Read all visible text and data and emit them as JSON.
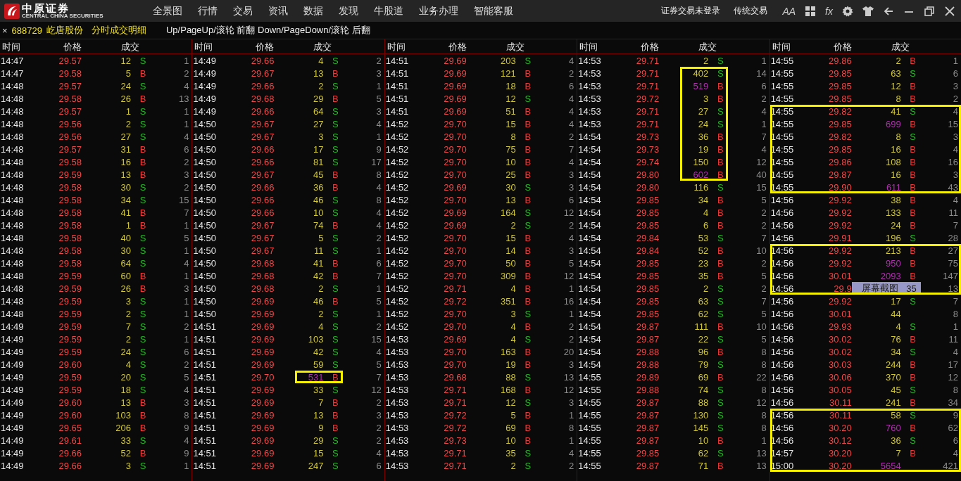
{
  "logo": {
    "name": "中原证券",
    "subtitle": "CENTRAL CHINA SECURITIES"
  },
  "menu": [
    "全景图",
    "行情",
    "交易",
    "资讯",
    "数据",
    "发现",
    "牛股道",
    "业务办理",
    "智能客服"
  ],
  "account_status": "证券交易未登录",
  "classic_trading": "传统交易",
  "tools": [
    {
      "kind": "text",
      "label": "AA"
    },
    {
      "kind": "grid"
    },
    {
      "kind": "text",
      "label": "fx"
    },
    {
      "kind": "gear"
    },
    {
      "kind": "shirt"
    },
    {
      "kind": "back"
    },
    {
      "kind": "minimize"
    },
    {
      "kind": "restore"
    },
    {
      "kind": "close"
    }
  ],
  "tab": {
    "close": "×",
    "code": "688729",
    "name": "屹唐股份",
    "title": "分时成交明细",
    "hint": "Up/PageUp/滚轮 前翻 Down/PageDown/滚轮 后翻"
  },
  "popup": {
    "label": "屏幕截图",
    "value": "35"
  },
  "columns": [
    {
      "headers": [
        "时间",
        "价格",
        "成交"
      ],
      "rows": [
        {
          "time": "14:47",
          "price": "29.57",
          "volume": "12",
          "side": "S",
          "kind": "sell",
          "trades": "1",
          "large": false,
          "boxed": false
        },
        {
          "time": "14:47",
          "price": "29.58",
          "volume": "5",
          "side": "B",
          "kind": "buy",
          "trades": "2",
          "large": false,
          "boxed": false
        },
        {
          "time": "14:48",
          "price": "29.57",
          "volume": "24",
          "side": "S",
          "kind": "sell",
          "trades": "4",
          "large": false,
          "boxed": false
        },
        {
          "time": "14:48",
          "price": "29.58",
          "volume": "26",
          "side": "B",
          "kind": "buy",
          "trades": "13",
          "large": false,
          "boxed": false
        },
        {
          "time": "14:48",
          "price": "29.57",
          "volume": "1",
          "side": "S",
          "kind": "sell",
          "trades": "1",
          "large": false,
          "boxed": false
        },
        {
          "time": "14:48",
          "price": "29.56",
          "volume": "2",
          "side": "S",
          "kind": "sell",
          "trades": "1",
          "large": false,
          "boxed": false
        },
        {
          "time": "14:48",
          "price": "29.56",
          "volume": "27",
          "side": "S",
          "kind": "sell",
          "trades": "4",
          "large": false,
          "boxed": false
        },
        {
          "time": "14:48",
          "price": "29.57",
          "volume": "31",
          "side": "B",
          "kind": "buy",
          "trades": "6",
          "large": false,
          "boxed": false
        },
        {
          "time": "14:48",
          "price": "29.58",
          "volume": "16",
          "side": "B",
          "kind": "buy",
          "trades": "2",
          "large": false,
          "boxed": false
        },
        {
          "time": "14:48",
          "price": "29.59",
          "volume": "13",
          "side": "B",
          "kind": "buy",
          "trades": "3",
          "large": false,
          "boxed": false
        },
        {
          "time": "14:48",
          "price": "29.58",
          "volume": "30",
          "side": "S",
          "kind": "sell",
          "trades": "2",
          "large": false,
          "boxed": false
        },
        {
          "time": "14:48",
          "price": "29.58",
          "volume": "34",
          "side": "S",
          "kind": "sell",
          "trades": "15",
          "large": false,
          "boxed": false
        },
        {
          "time": "14:48",
          "price": "29.58",
          "volume": "41",
          "side": "B",
          "kind": "buy",
          "trades": "7",
          "large": false,
          "boxed": false
        },
        {
          "time": "14:48",
          "price": "29.58",
          "volume": "1",
          "side": "B",
          "kind": "buy",
          "trades": "1",
          "large": false,
          "boxed": false
        },
        {
          "time": "14:48",
          "price": "29.58",
          "volume": "40",
          "side": "S",
          "kind": "sell",
          "trades": "5",
          "large": false,
          "boxed": false
        },
        {
          "time": "14:48",
          "price": "29.58",
          "volume": "30",
          "side": "S",
          "kind": "sell",
          "trades": "1",
          "large": false,
          "boxed": false
        },
        {
          "time": "14:48",
          "price": "29.58",
          "volume": "64",
          "side": "S",
          "kind": "sell",
          "trades": "4",
          "large": false,
          "boxed": false
        },
        {
          "time": "14:48",
          "price": "29.59",
          "volume": "60",
          "side": "B",
          "kind": "buy",
          "trades": "1",
          "large": false,
          "boxed": false
        },
        {
          "time": "14:48",
          "price": "29.59",
          "volume": "26",
          "side": "B",
          "kind": "buy",
          "trades": "3",
          "large": false,
          "boxed": false
        },
        {
          "time": "14:48",
          "price": "29.59",
          "volume": "3",
          "side": "S",
          "kind": "sell",
          "trades": "1",
          "large": false,
          "boxed": false
        },
        {
          "time": "14:48",
          "price": "29.59",
          "volume": "2",
          "side": "S",
          "kind": "sell",
          "trades": "1",
          "large": false,
          "boxed": false
        },
        {
          "time": "14:49",
          "price": "29.59",
          "volume": "7",
          "side": "S",
          "kind": "sell",
          "trades": "2",
          "large": false,
          "boxed": false
        },
        {
          "time": "14:49",
          "price": "29.59",
          "volume": "2",
          "side": "S",
          "kind": "sell",
          "trades": "1",
          "large": false,
          "boxed": false
        },
        {
          "time": "14:49",
          "price": "29.59",
          "volume": "24",
          "side": "S",
          "kind": "sell",
          "trades": "6",
          "large": false,
          "boxed": false
        },
        {
          "time": "14:49",
          "price": "29.60",
          "volume": "4",
          "side": "S",
          "kind": "sell",
          "trades": "2",
          "large": false,
          "boxed": false
        },
        {
          "time": "14:49",
          "price": "29.59",
          "volume": "20",
          "side": "S",
          "kind": "sell",
          "trades": "5",
          "large": false,
          "boxed": false
        },
        {
          "time": "14:49",
          "price": "29.59",
          "volume": "18",
          "side": "S",
          "kind": "sell",
          "trades": "4",
          "large": false,
          "boxed": false
        },
        {
          "time": "14:49",
          "price": "29.60",
          "volume": "13",
          "side": "B",
          "kind": "buy",
          "trades": "3",
          "large": false,
          "boxed": false
        },
        {
          "time": "14:49",
          "price": "29.60",
          "volume": "103",
          "side": "B",
          "kind": "buy",
          "trades": "8",
          "large": false,
          "boxed": false
        },
        {
          "time": "14:49",
          "price": "29.65",
          "volume": "206",
          "side": "B",
          "kind": "buy",
          "trades": "9",
          "large": false,
          "boxed": false
        },
        {
          "time": "14:49",
          "price": "29.61",
          "volume": "33",
          "side": "S",
          "kind": "sell",
          "trades": "4",
          "large": false,
          "boxed": false
        },
        {
          "time": "14:49",
          "price": "29.66",
          "volume": "52",
          "side": "B",
          "kind": "buy",
          "trades": "9",
          "large": false,
          "boxed": false
        },
        {
          "time": "14:49",
          "price": "29.66",
          "volume": "3",
          "side": "S",
          "kind": "sell",
          "trades": "1",
          "large": false,
          "boxed": false
        }
      ]
    },
    {
      "headers": [
        "时间",
        "价格",
        "成交"
      ],
      "rows": [
        {
          "time": "14:49",
          "price": "29.66",
          "volume": "4",
          "side": "S",
          "kind": "sell",
          "trades": "2",
          "large": false,
          "boxed": false
        },
        {
          "time": "14:49",
          "price": "29.67",
          "volume": "13",
          "side": "B",
          "kind": "buy",
          "trades": "3",
          "large": false,
          "boxed": false
        },
        {
          "time": "14:49",
          "price": "29.66",
          "volume": "2",
          "side": "S",
          "kind": "sell",
          "trades": "1",
          "large": false,
          "boxed": false
        },
        {
          "time": "14:49",
          "price": "29.68",
          "volume": "29",
          "side": "B",
          "kind": "buy",
          "trades": "5",
          "large": false,
          "boxed": false
        },
        {
          "time": "14:49",
          "price": "29.66",
          "volume": "64",
          "side": "S",
          "kind": "sell",
          "trades": "3",
          "large": false,
          "boxed": false
        },
        {
          "time": "14:50",
          "price": "29.67",
          "volume": "27",
          "side": "S",
          "kind": "sell",
          "trades": "4",
          "large": false,
          "boxed": false
        },
        {
          "time": "14:50",
          "price": "29.67",
          "volume": "3",
          "side": "S",
          "kind": "sell",
          "trades": "1",
          "large": false,
          "boxed": false
        },
        {
          "time": "14:50",
          "price": "29.66",
          "volume": "17",
          "side": "S",
          "kind": "sell",
          "trades": "9",
          "large": false,
          "boxed": false
        },
        {
          "time": "14:50",
          "price": "29.66",
          "volume": "81",
          "side": "S",
          "kind": "sell",
          "trades": "17",
          "large": false,
          "boxed": false
        },
        {
          "time": "14:50",
          "price": "29.67",
          "volume": "45",
          "side": "B",
          "kind": "buy",
          "trades": "8",
          "large": false,
          "boxed": false
        },
        {
          "time": "14:50",
          "price": "29.66",
          "volume": "36",
          "side": "B",
          "kind": "buy",
          "trades": "4",
          "large": false,
          "boxed": false
        },
        {
          "time": "14:50",
          "price": "29.66",
          "volume": "46",
          "side": "S",
          "kind": "sell",
          "trades": "8",
          "large": false,
          "boxed": false
        },
        {
          "time": "14:50",
          "price": "29.66",
          "volume": "10",
          "side": "S",
          "kind": "sell",
          "trades": "4",
          "large": false,
          "boxed": false
        },
        {
          "time": "14:50",
          "price": "29.67",
          "volume": "74",
          "side": "B",
          "kind": "buy",
          "trades": "4",
          "large": false,
          "boxed": false
        },
        {
          "time": "14:50",
          "price": "29.67",
          "volume": "5",
          "side": "S",
          "kind": "sell",
          "trades": "2",
          "large": false,
          "boxed": false
        },
        {
          "time": "14:50",
          "price": "29.67",
          "volume": "11",
          "side": "S",
          "kind": "sell",
          "trades": "1",
          "large": false,
          "boxed": false
        },
        {
          "time": "14:50",
          "price": "29.68",
          "volume": "41",
          "side": "B",
          "kind": "buy",
          "trades": "6",
          "large": false,
          "boxed": false
        },
        {
          "time": "14:50",
          "price": "29.68",
          "volume": "42",
          "side": "B",
          "kind": "buy",
          "trades": "7",
          "large": false,
          "boxed": false
        },
        {
          "time": "14:50",
          "price": "29.68",
          "volume": "2",
          "side": "S",
          "kind": "sell",
          "trades": "1",
          "large": false,
          "boxed": false
        },
        {
          "time": "14:50",
          "price": "29.69",
          "volume": "46",
          "side": "B",
          "kind": "buy",
          "trades": "5",
          "large": false,
          "boxed": false
        },
        {
          "time": "14:50",
          "price": "29.69",
          "volume": "2",
          "side": "S",
          "kind": "sell",
          "trades": "1",
          "large": false,
          "boxed": false
        },
        {
          "time": "14:51",
          "price": "29.69",
          "volume": "4",
          "side": "S",
          "kind": "sell",
          "trades": "2",
          "large": false,
          "boxed": false
        },
        {
          "time": "14:51",
          "price": "29.69",
          "volume": "103",
          "side": "S",
          "kind": "sell",
          "trades": "15",
          "large": false,
          "boxed": false
        },
        {
          "time": "14:51",
          "price": "29.69",
          "volume": "42",
          "side": "S",
          "kind": "sell",
          "trades": "4",
          "large": false,
          "boxed": false
        },
        {
          "time": "14:51",
          "price": "29.69",
          "volume": "59",
          "side": "S",
          "kind": "sell",
          "trades": "5",
          "large": false,
          "boxed": false
        },
        {
          "time": "14:51",
          "price": "29.70",
          "volume": "531",
          "side": "B",
          "kind": "buy",
          "trades": "7",
          "large": true,
          "boxed": true
        },
        {
          "time": "14:51",
          "price": "29.69",
          "volume": "33",
          "side": "S",
          "kind": "sell",
          "trades": "12",
          "large": false,
          "boxed": false
        },
        {
          "time": "14:51",
          "price": "29.69",
          "volume": "7",
          "side": "B",
          "kind": "buy",
          "trades": "2",
          "large": false,
          "boxed": false
        },
        {
          "time": "14:51",
          "price": "29.69",
          "volume": "13",
          "side": "B",
          "kind": "buy",
          "trades": "3",
          "large": false,
          "boxed": false
        },
        {
          "time": "14:51",
          "price": "29.69",
          "volume": "9",
          "side": "B",
          "kind": "buy",
          "trades": "2",
          "large": false,
          "boxed": false
        },
        {
          "time": "14:51",
          "price": "29.69",
          "volume": "29",
          "side": "S",
          "kind": "sell",
          "trades": "2",
          "large": false,
          "boxed": false
        },
        {
          "time": "14:51",
          "price": "29.69",
          "volume": "15",
          "side": "S",
          "kind": "sell",
          "trades": "4",
          "large": false,
          "boxed": false
        },
        {
          "time": "14:51",
          "price": "29.69",
          "volume": "247",
          "side": "S",
          "kind": "sell",
          "trades": "6",
          "large": false,
          "boxed": false
        }
      ]
    },
    {
      "headers": [
        "时间",
        "价格",
        "成交"
      ],
      "rows": [
        {
          "time": "14:51",
          "price": "29.69",
          "volume": "203",
          "side": "S",
          "kind": "sell",
          "trades": "4",
          "large": false,
          "boxed": false
        },
        {
          "time": "14:51",
          "price": "29.69",
          "volume": "121",
          "side": "B",
          "kind": "buy",
          "trades": "2",
          "large": false,
          "boxed": false
        },
        {
          "time": "14:51",
          "price": "29.69",
          "volume": "18",
          "side": "B",
          "kind": "buy",
          "trades": "6",
          "large": false,
          "boxed": false
        },
        {
          "time": "14:51",
          "price": "29.69",
          "volume": "12",
          "side": "S",
          "kind": "sell",
          "trades": "4",
          "large": false,
          "boxed": false
        },
        {
          "time": "14:51",
          "price": "29.69",
          "volume": "51",
          "side": "B",
          "kind": "buy",
          "trades": "4",
          "large": false,
          "boxed": false
        },
        {
          "time": "14:52",
          "price": "29.70",
          "volume": "15",
          "side": "B",
          "kind": "buy",
          "trades": "4",
          "large": false,
          "boxed": false
        },
        {
          "time": "14:52",
          "price": "29.70",
          "volume": "8",
          "side": "B",
          "kind": "buy",
          "trades": "2",
          "large": false,
          "boxed": false
        },
        {
          "time": "14:52",
          "price": "29.70",
          "volume": "75",
          "side": "B",
          "kind": "buy",
          "trades": "7",
          "large": false,
          "boxed": false
        },
        {
          "time": "14:52",
          "price": "29.70",
          "volume": "10",
          "side": "B",
          "kind": "buy",
          "trades": "4",
          "large": false,
          "boxed": false
        },
        {
          "time": "14:52",
          "price": "29.70",
          "volume": "25",
          "side": "B",
          "kind": "buy",
          "trades": "3",
          "large": false,
          "boxed": false
        },
        {
          "time": "14:52",
          "price": "29.69",
          "volume": "30",
          "side": "S",
          "kind": "sell",
          "trades": "3",
          "large": false,
          "boxed": false
        },
        {
          "time": "14:52",
          "price": "29.70",
          "volume": "13",
          "side": "B",
          "kind": "buy",
          "trades": "6",
          "large": false,
          "boxed": false
        },
        {
          "time": "14:52",
          "price": "29.69",
          "volume": "164",
          "side": "S",
          "kind": "sell",
          "trades": "12",
          "large": false,
          "boxed": false
        },
        {
          "time": "14:52",
          "price": "29.69",
          "volume": "2",
          "side": "S",
          "kind": "sell",
          "trades": "2",
          "large": false,
          "boxed": false
        },
        {
          "time": "14:52",
          "price": "29.70",
          "volume": "15",
          "side": "B",
          "kind": "buy",
          "trades": "4",
          "large": false,
          "boxed": false
        },
        {
          "time": "14:52",
          "price": "29.70",
          "volume": "14",
          "side": "B",
          "kind": "buy",
          "trades": "3",
          "large": false,
          "boxed": false
        },
        {
          "time": "14:52",
          "price": "29.70",
          "volume": "50",
          "side": "B",
          "kind": "buy",
          "trades": "5",
          "large": false,
          "boxed": false
        },
        {
          "time": "14:52",
          "price": "29.70",
          "volume": "309",
          "side": "B",
          "kind": "buy",
          "trades": "12",
          "large": false,
          "boxed": false
        },
        {
          "time": "14:52",
          "price": "29.71",
          "volume": "4",
          "side": "B",
          "kind": "buy",
          "trades": "1",
          "large": false,
          "boxed": false
        },
        {
          "time": "14:52",
          "price": "29.72",
          "volume": "351",
          "side": "B",
          "kind": "buy",
          "trades": "16",
          "large": false,
          "boxed": false
        },
        {
          "time": "14:52",
          "price": "29.70",
          "volume": "3",
          "side": "S",
          "kind": "sell",
          "trades": "1",
          "large": false,
          "boxed": false
        },
        {
          "time": "14:52",
          "price": "29.70",
          "volume": "4",
          "side": "B",
          "kind": "buy",
          "trades": "2",
          "large": false,
          "boxed": false
        },
        {
          "time": "14:53",
          "price": "29.69",
          "volume": "4",
          "side": "S",
          "kind": "sell",
          "trades": "2",
          "large": false,
          "boxed": false
        },
        {
          "time": "14:53",
          "price": "29.70",
          "volume": "163",
          "side": "B",
          "kind": "buy",
          "trades": "20",
          "large": false,
          "boxed": false
        },
        {
          "time": "14:53",
          "price": "29.70",
          "volume": "19",
          "side": "B",
          "kind": "buy",
          "trades": "3",
          "large": false,
          "boxed": false
        },
        {
          "time": "14:53",
          "price": "29.68",
          "volume": "88",
          "side": "S",
          "kind": "sell",
          "trades": "13",
          "large": false,
          "boxed": false
        },
        {
          "time": "14:53",
          "price": "29.71",
          "volume": "168",
          "side": "B",
          "kind": "buy",
          "trades": "12",
          "large": false,
          "boxed": false
        },
        {
          "time": "14:53",
          "price": "29.71",
          "volume": "12",
          "side": "S",
          "kind": "sell",
          "trades": "3",
          "large": false,
          "boxed": false
        },
        {
          "time": "14:53",
          "price": "29.72",
          "volume": "5",
          "side": "B",
          "kind": "buy",
          "trades": "1",
          "large": false,
          "boxed": false
        },
        {
          "time": "14:53",
          "price": "29.72",
          "volume": "69",
          "side": "B",
          "kind": "buy",
          "trades": "8",
          "large": false,
          "boxed": false
        },
        {
          "time": "14:53",
          "price": "29.73",
          "volume": "10",
          "side": "B",
          "kind": "buy",
          "trades": "1",
          "large": false,
          "boxed": false
        },
        {
          "time": "14:53",
          "price": "29.71",
          "volume": "35",
          "side": "S",
          "kind": "sell",
          "trades": "4",
          "large": false,
          "boxed": false
        },
        {
          "time": "14:53",
          "price": "29.71",
          "volume": "2",
          "side": "S",
          "kind": "sell",
          "trades": "2",
          "large": false,
          "boxed": false
        }
      ]
    },
    {
      "headers": [
        "时间",
        "价格",
        "成交"
      ],
      "rows": [
        {
          "time": "14:53",
          "price": "29.71",
          "volume": "2",
          "side": "S",
          "kind": "sell",
          "trades": "1",
          "large": false,
          "boxed": false
        },
        {
          "time": "14:53",
          "price": "29.71",
          "volume": "402",
          "side": "S",
          "kind": "sell",
          "trades": "14",
          "large": false,
          "boxed": true
        },
        {
          "time": "14:53",
          "price": "29.71",
          "volume": "519",
          "side": "B",
          "kind": "buy",
          "trades": "6",
          "large": true,
          "boxed": true
        },
        {
          "time": "14:53",
          "price": "29.72",
          "volume": "3",
          "side": "B",
          "kind": "buy",
          "trades": "2",
          "large": false,
          "boxed": true
        },
        {
          "time": "14:53",
          "price": "29.71",
          "volume": "27",
          "side": "S",
          "kind": "sell",
          "trades": "4",
          "large": false,
          "boxed": true
        },
        {
          "time": "14:53",
          "price": "29.71",
          "volume": "24",
          "side": "S",
          "kind": "sell",
          "trades": "1",
          "large": false,
          "boxed": true
        },
        {
          "time": "14:54",
          "price": "29.73",
          "volume": "36",
          "side": "B",
          "kind": "buy",
          "trades": "7",
          "large": false,
          "boxed": true
        },
        {
          "time": "14:54",
          "price": "29.73",
          "volume": "19",
          "side": "B",
          "kind": "buy",
          "trades": "4",
          "large": false,
          "boxed": true
        },
        {
          "time": "14:54",
          "price": "29.74",
          "volume": "150",
          "side": "B",
          "kind": "buy",
          "trades": "12",
          "large": false,
          "boxed": true
        },
        {
          "time": "14:54",
          "price": "29.80",
          "volume": "602",
          "side": "B",
          "kind": "buy",
          "trades": "40",
          "large": true,
          "boxed": true
        },
        {
          "time": "14:54",
          "price": "29.80",
          "volume": "116",
          "side": "S",
          "kind": "sell",
          "trades": "15",
          "large": false,
          "boxed": false
        },
        {
          "time": "14:54",
          "price": "29.85",
          "volume": "34",
          "side": "B",
          "kind": "buy",
          "trades": "5",
          "large": false,
          "boxed": false
        },
        {
          "time": "14:54",
          "price": "29.85",
          "volume": "4",
          "side": "B",
          "kind": "buy",
          "trades": "2",
          "large": false,
          "boxed": false
        },
        {
          "time": "14:54",
          "price": "29.85",
          "volume": "6",
          "side": "B",
          "kind": "buy",
          "trades": "2",
          "large": false,
          "boxed": false
        },
        {
          "time": "14:54",
          "price": "29.84",
          "volume": "53",
          "side": "S",
          "kind": "sell",
          "trades": "7",
          "large": false,
          "boxed": false
        },
        {
          "time": "14:54",
          "price": "29.84",
          "volume": "52",
          "side": "B",
          "kind": "buy",
          "trades": "10",
          "large": false,
          "boxed": false
        },
        {
          "time": "14:54",
          "price": "29.85",
          "volume": "23",
          "side": "B",
          "kind": "buy",
          "trades": "2",
          "large": false,
          "boxed": false
        },
        {
          "time": "14:54",
          "price": "29.85",
          "volume": "35",
          "side": "B",
          "kind": "buy",
          "trades": "5",
          "large": false,
          "boxed": false
        },
        {
          "time": "14:54",
          "price": "29.85",
          "volume": "2",
          "side": "S",
          "kind": "sell",
          "trades": "2",
          "large": false,
          "boxed": false
        },
        {
          "time": "14:54",
          "price": "29.85",
          "volume": "63",
          "side": "S",
          "kind": "sell",
          "trades": "7",
          "large": false,
          "boxed": false
        },
        {
          "time": "14:54",
          "price": "29.85",
          "volume": "62",
          "side": "S",
          "kind": "sell",
          "trades": "5",
          "large": false,
          "boxed": false
        },
        {
          "time": "14:54",
          "price": "29.87",
          "volume": "111",
          "side": "B",
          "kind": "buy",
          "trades": "10",
          "large": false,
          "boxed": false
        },
        {
          "time": "14:54",
          "price": "29.87",
          "volume": "22",
          "side": "S",
          "kind": "sell",
          "trades": "5",
          "large": false,
          "boxed": false
        },
        {
          "time": "14:54",
          "price": "29.88",
          "volume": "96",
          "side": "B",
          "kind": "buy",
          "trades": "8",
          "large": false,
          "boxed": false
        },
        {
          "time": "14:54",
          "price": "29.88",
          "volume": "79",
          "side": "S",
          "kind": "sell",
          "trades": "8",
          "large": false,
          "boxed": false
        },
        {
          "time": "14:55",
          "price": "29.89",
          "volume": "69",
          "side": "B",
          "kind": "buy",
          "trades": "22",
          "large": false,
          "boxed": false
        },
        {
          "time": "14:55",
          "price": "29.88",
          "volume": "74",
          "side": "S",
          "kind": "sell",
          "trades": "8",
          "large": false,
          "boxed": false
        },
        {
          "time": "14:55",
          "price": "29.87",
          "volume": "88",
          "side": "S",
          "kind": "sell",
          "trades": "12",
          "large": false,
          "boxed": false
        },
        {
          "time": "14:55",
          "price": "29.87",
          "volume": "130",
          "side": "S",
          "kind": "sell",
          "trades": "8",
          "large": false,
          "boxed": false
        },
        {
          "time": "14:55",
          "price": "29.87",
          "volume": "145",
          "side": "S",
          "kind": "sell",
          "trades": "8",
          "large": false,
          "boxed": false
        },
        {
          "time": "14:55",
          "price": "29.87",
          "volume": "10",
          "side": "B",
          "kind": "buy",
          "trades": "1",
          "large": false,
          "boxed": false
        },
        {
          "time": "14:55",
          "price": "29.85",
          "volume": "62",
          "side": "S",
          "kind": "sell",
          "trades": "13",
          "large": false,
          "boxed": false
        },
        {
          "time": "14:55",
          "price": "29.87",
          "volume": "71",
          "side": "B",
          "kind": "buy",
          "trades": "13",
          "large": false,
          "boxed": false
        }
      ]
    },
    {
      "headers": [
        "时间",
        "价格",
        "成交"
      ],
      "rows": [
        {
          "time": "14:55",
          "price": "29.86",
          "volume": "2",
          "side": "B",
          "kind": "buy",
          "trades": "1",
          "large": false,
          "boxed": false
        },
        {
          "time": "14:55",
          "price": "29.85",
          "volume": "63",
          "side": "S",
          "kind": "sell",
          "trades": "6",
          "large": false,
          "boxed": false
        },
        {
          "time": "14:55",
          "price": "29.85",
          "volume": "12",
          "side": "B",
          "kind": "buy",
          "trades": "3",
          "large": false,
          "boxed": false
        },
        {
          "time": "14:55",
          "price": "29.85",
          "volume": "8",
          "side": "B",
          "kind": "buy",
          "trades": "2",
          "large": false,
          "boxed": false
        },
        {
          "time": "14:55",
          "price": "29.82",
          "volume": "41",
          "side": "S",
          "kind": "sell",
          "trades": "4",
          "large": false,
          "boxed": true
        },
        {
          "time": "14:55",
          "price": "29.85",
          "volume": "699",
          "side": "B",
          "kind": "buy",
          "trades": "15",
          "large": true,
          "boxed": true
        },
        {
          "time": "14:55",
          "price": "29.82",
          "volume": "8",
          "side": "S",
          "kind": "sell",
          "trades": "3",
          "large": false,
          "boxed": true
        },
        {
          "time": "14:55",
          "price": "29.85",
          "volume": "16",
          "side": "B",
          "kind": "buy",
          "trades": "4",
          "large": false,
          "boxed": true
        },
        {
          "time": "14:55",
          "price": "29.86",
          "volume": "108",
          "side": "B",
          "kind": "buy",
          "trades": "16",
          "large": false,
          "boxed": true
        },
        {
          "time": "14:55",
          "price": "29.87",
          "volume": "16",
          "side": "B",
          "kind": "buy",
          "trades": "3",
          "large": false,
          "boxed": true
        },
        {
          "time": "14:55",
          "price": "29.90",
          "volume": "611",
          "side": "B",
          "kind": "buy",
          "trades": "43",
          "large": true,
          "boxed": true
        },
        {
          "time": "14:56",
          "price": "29.92",
          "volume": "38",
          "side": "B",
          "kind": "buy",
          "trades": "4",
          "large": false,
          "boxed": false
        },
        {
          "time": "14:56",
          "price": "29.92",
          "volume": "133",
          "side": "B",
          "kind": "buy",
          "trades": "11",
          "large": false,
          "boxed": false
        },
        {
          "time": "14:56",
          "price": "29.92",
          "volume": "24",
          "side": "B",
          "kind": "buy",
          "trades": "7",
          "large": false,
          "boxed": false
        },
        {
          "time": "14:56",
          "price": "29.91",
          "volume": "196",
          "side": "S",
          "kind": "sell",
          "trades": "28",
          "large": false,
          "boxed": false
        },
        {
          "time": "14:56",
          "price": "29.92",
          "volume": "213",
          "side": "B",
          "kind": "buy",
          "trades": "27",
          "large": false,
          "boxed": true
        },
        {
          "time": "14:56",
          "price": "29.92",
          "volume": "950",
          "side": "B",
          "kind": "buy",
          "trades": "75",
          "large": true,
          "boxed": true
        },
        {
          "time": "14:56",
          "price": "30.01",
          "volume": "2093",
          "side": "B",
          "kind": "buy",
          "trades": "147",
          "large": true,
          "boxed": true
        },
        {
          "time": "14:56",
          "price": "29.9",
          "trades": "13",
          "covered": true,
          "boxed": true
        },
        {
          "time": "14:56",
          "price": "29.92",
          "volume": "17",
          "side": "S",
          "kind": "sell",
          "trades": "7",
          "large": false,
          "boxed": false
        },
        {
          "time": "14:56",
          "price": "30.01",
          "volume": "44",
          "trades": "8",
          "large": false,
          "boxed": false
        },
        {
          "time": "14:56",
          "price": "29.93",
          "volume": "4",
          "side": "S",
          "kind": "sell",
          "trades": "1",
          "large": false,
          "boxed": false
        },
        {
          "time": "14:56",
          "price": "30.02",
          "volume": "76",
          "side": "B",
          "kind": "buy",
          "trades": "11",
          "large": false,
          "boxed": false
        },
        {
          "time": "14:56",
          "price": "30.02",
          "volume": "34",
          "side": "S",
          "kind": "sell",
          "trades": "4",
          "large": false,
          "boxed": false
        },
        {
          "time": "14:56",
          "price": "30.03",
          "volume": "244",
          "side": "B",
          "kind": "buy",
          "trades": "17",
          "large": false,
          "boxed": false
        },
        {
          "time": "14:56",
          "price": "30.06",
          "volume": "370",
          "side": "B",
          "kind": "buy",
          "trades": "12",
          "large": false,
          "boxed": false
        },
        {
          "time": "14:56",
          "price": "30.05",
          "volume": "45",
          "side": "S",
          "kind": "sell",
          "trades": "8",
          "large": false,
          "boxed": false
        },
        {
          "time": "14:56",
          "price": "30.11",
          "volume": "241",
          "side": "B",
          "kind": "buy",
          "trades": "34",
          "large": false,
          "boxed": false
        },
        {
          "time": "14:56",
          "price": "30.11",
          "volume": "58",
          "side": "S",
          "kind": "sell",
          "trades": "9",
          "large": false,
          "boxed": true
        },
        {
          "time": "14:56",
          "price": "30.20",
          "volume": "760",
          "side": "B",
          "kind": "buy",
          "trades": "62",
          "large": true,
          "boxed": true
        },
        {
          "time": "14:56",
          "price": "30.12",
          "volume": "36",
          "side": "S",
          "kind": "sell",
          "trades": "6",
          "large": false,
          "boxed": true
        },
        {
          "time": "14:57",
          "price": "30.20",
          "volume": "7",
          "side": "B",
          "kind": "buy",
          "trades": "4",
          "large": false,
          "boxed": true
        },
        {
          "time": "15:00",
          "price": "30.20",
          "volume": "5654",
          "trades": "421",
          "large": true,
          "boxed": true
        }
      ]
    }
  ]
}
